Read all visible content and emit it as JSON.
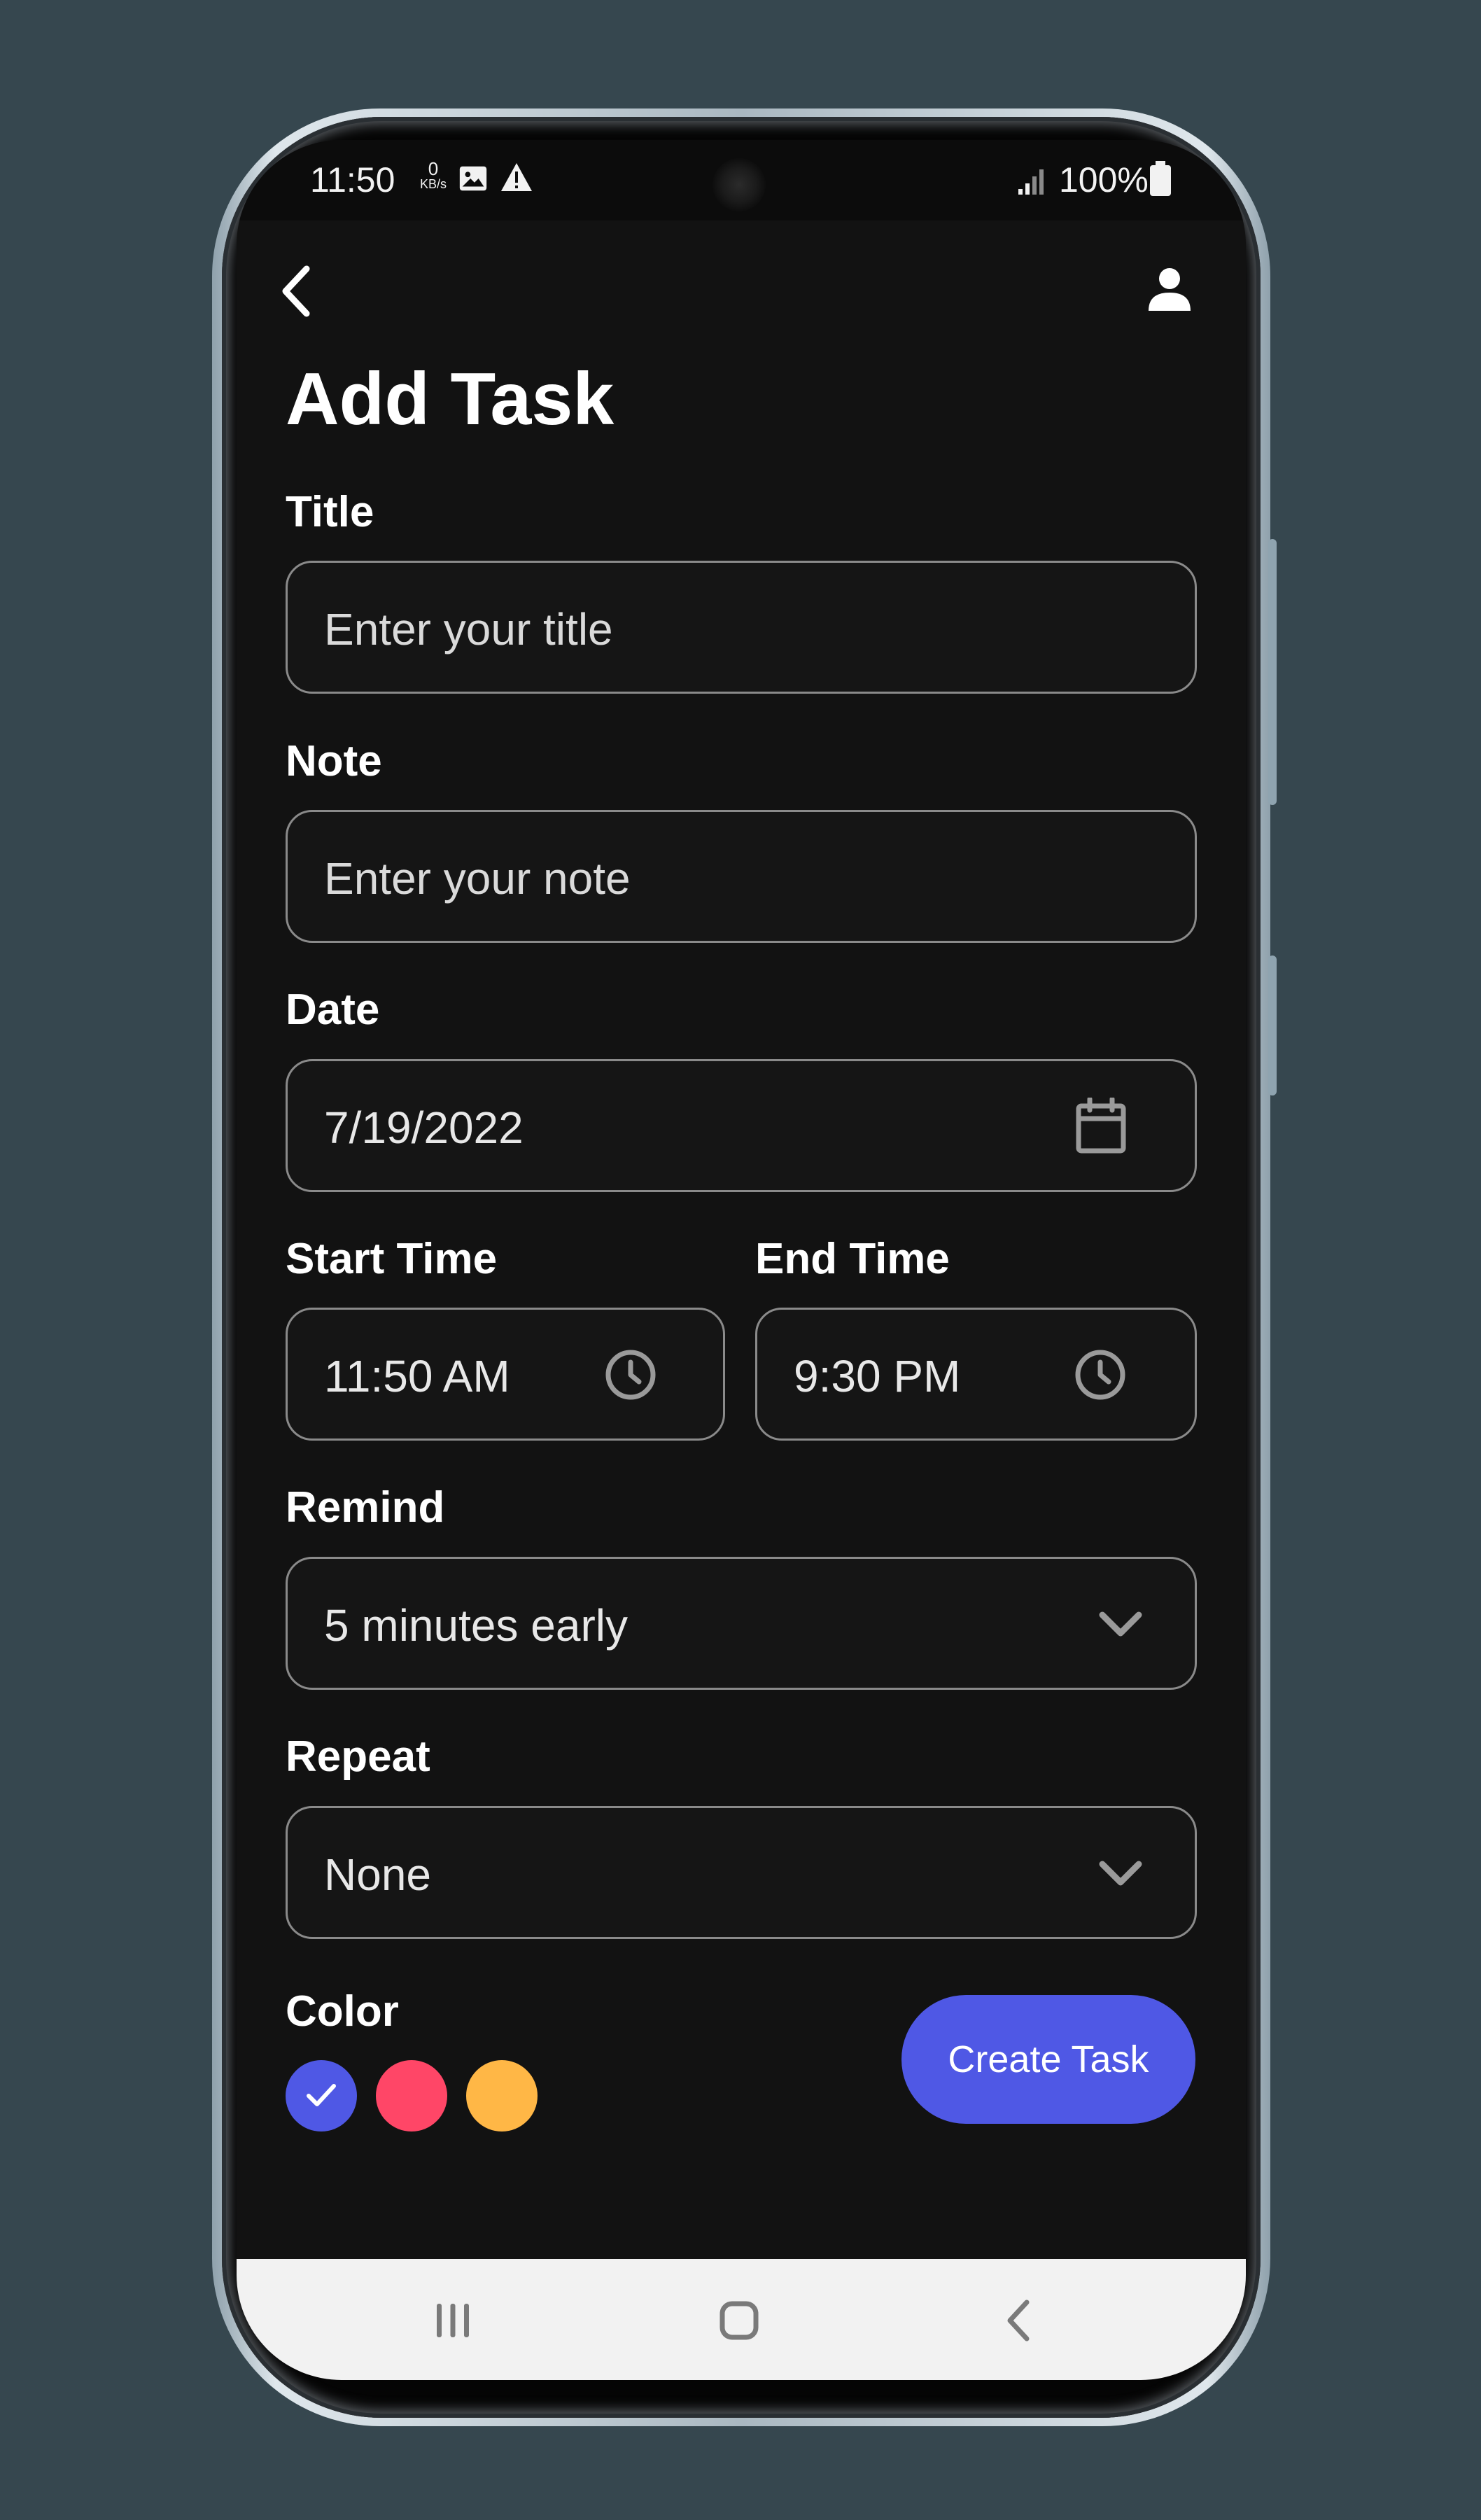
{
  "status_bar": {
    "time": "11:50",
    "net_speed_value": "0",
    "net_speed_unit": "KB/s",
    "battery": "100%",
    "icons": [
      "image-icon",
      "warning-icon",
      "signal-icon",
      "battery-icon"
    ]
  },
  "header": {
    "back_icon": "chevron-left-icon",
    "profile_icon": "person-icon",
    "title": "Add Task"
  },
  "form": {
    "title_label": "Title",
    "title_placeholder": "Enter your title",
    "note_label": "Note",
    "note_placeholder": "Enter your note",
    "date_label": "Date",
    "date_value": "7/19/2022",
    "start_time_label": "Start Time",
    "start_time_value": "11:50 AM",
    "end_time_label": "End Time",
    "end_time_value": "9:30 PM",
    "remind_label": "Remind",
    "remind_value": "5 minutes early",
    "repeat_label": "Repeat",
    "repeat_value": "None",
    "color_label": "Color",
    "colors": [
      "#4f58e5",
      "#ff4667",
      "#ffb746"
    ],
    "selected_color_index": 0,
    "create_button": "Create Task"
  },
  "nav_bar": {
    "items": [
      "recent-apps-icon",
      "home-icon",
      "back-icon"
    ]
  }
}
